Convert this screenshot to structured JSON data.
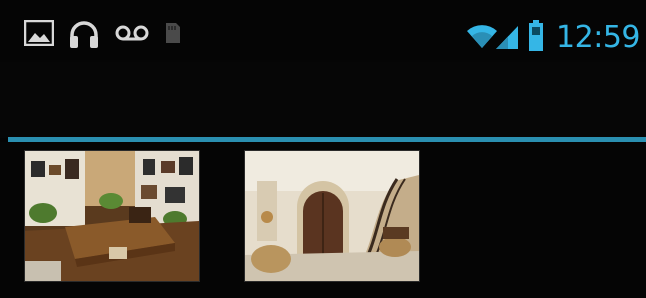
{
  "status_bar": {
    "left_icons": [
      "gallery-notification-icon",
      "headphones-icon",
      "voicemail-icon",
      "sd-card-icon"
    ],
    "right_icons": [
      "wifi-icon",
      "signal-icon",
      "battery-icon"
    ],
    "time": "12:59",
    "accent_color": "#35b6e6"
  },
  "action_bar": {
    "divider_color": "#2a8fb0"
  },
  "gallery": {
    "items": [
      {
        "icon": "library-room-thumbnail"
      },
      {
        "icon": "foyer-staircase-thumbnail"
      }
    ]
  }
}
